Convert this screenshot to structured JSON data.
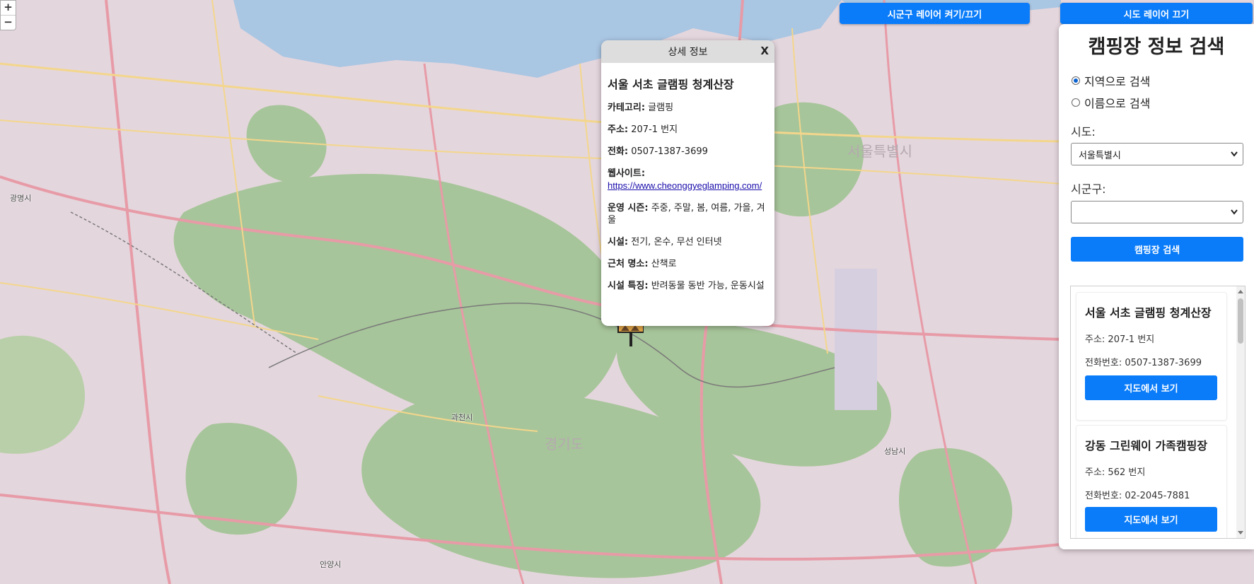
{
  "map": {
    "zoom_in": "+",
    "zoom_out": "−",
    "labels": {
      "gwacheon": "과천시",
      "gyeonggi": "경기도",
      "seongnam": "성남시",
      "gwangmyeong": "광명시",
      "anyang": "안양시",
      "seoul": "서울특별시"
    }
  },
  "toolbar": {
    "sigungu_toggle": "시군구 레이어 켜기/끄기",
    "sido_toggle": "시도 레이어 끄기"
  },
  "popup": {
    "header": "상세 정보",
    "close": "X",
    "title": "서울 서초 글램핑 청계산장",
    "rows": {
      "category": {
        "label": "카테고리:",
        "value": " 글램핑"
      },
      "address": {
        "label": "주소:",
        "value": " 207-1 번지"
      },
      "phone": {
        "label": "전화:",
        "value": " 0507-1387-3699"
      },
      "website": {
        "label": "웹사이트:",
        "value": "https://www.cheonggyeglamping.com/"
      },
      "season": {
        "label": "운영 시즌:",
        "value": " 주중, 주말, 봄, 여름, 가을, 겨울"
      },
      "facilities": {
        "label": "시설:",
        "value": " 전기, 온수, 무선 인터넷"
      },
      "nearby": {
        "label": "근처 명소:",
        "value": " 산책로"
      },
      "features": {
        "label": "시설 특징:",
        "value": " 반려동물 동반 가능, 운동시설"
      }
    }
  },
  "panel": {
    "title": "캠핑장 정보 검색",
    "search_mode": {
      "by_region": "지역으로 검색",
      "by_name": "이름으로 검색",
      "selected": "지역으로 검색"
    },
    "sido_label": "시도:",
    "sido_value": "서울특별시",
    "sigungu_label": "시군구:",
    "sigungu_value": "",
    "search_button": "캠핑장 검색",
    "results": [
      {
        "name": "서울 서초 글램핑 청계산장",
        "address": "주소: 207-1 번지",
        "phone": "전화번호: 0507-1387-3699",
        "button": "지도에서 보기"
      },
      {
        "name": "강동 그린웨이 가족캠핑장",
        "address": "주소: 562 번지",
        "phone": "전화번호: 02-2045-7881",
        "button": "지도에서 보기"
      }
    ]
  },
  "colors": {
    "accent": "#0a7cf9",
    "water": "#a9c6e3",
    "forest": "#a7c59a",
    "urban": "#e2d4dc",
    "road_major": "#e79ba7",
    "road_minor": "#f3d68c"
  }
}
